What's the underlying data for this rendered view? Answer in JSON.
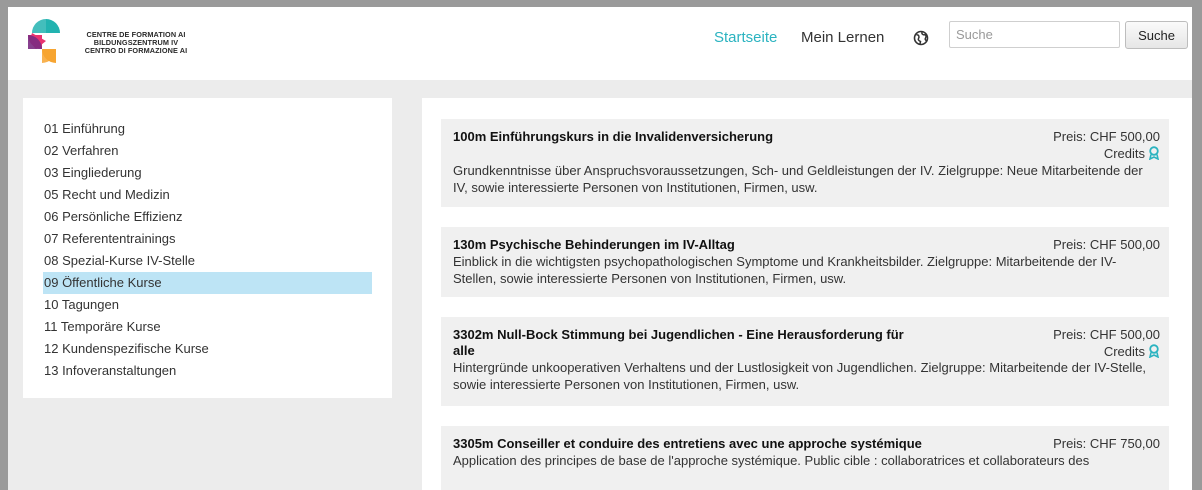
{
  "header": {
    "logo_lines": [
      "CENTRE DE FORMATION AI",
      "BILDUNGSZENTRUM IV",
      "CENTRO DI FORMAZIONE AI"
    ],
    "nav": {
      "home": "Startseite",
      "learn": "Mein Lernen"
    },
    "globe_icon": "globe-icon",
    "search": {
      "placeholder": "Suche",
      "value": "",
      "button": "Suche"
    }
  },
  "colors": {
    "accent": "#2bb3c0",
    "active_item": "#bde4f5",
    "page_bg": "#ececec",
    "card_bg": "#f0f0f0",
    "logo_teal": "#22b3b0",
    "logo_pink": "#e8336f",
    "logo_orange": "#f7a531",
    "logo_purple": "#7a2b82"
  },
  "sidebar": {
    "items": [
      {
        "label": "01 Einführung",
        "active": false
      },
      {
        "label": "02 Verfahren",
        "active": false
      },
      {
        "label": "03 Eingliederung",
        "active": false
      },
      {
        "label": "05 Recht und Medizin",
        "active": false
      },
      {
        "label": "06 Persönliche Effizienz",
        "active": false
      },
      {
        "label": "07 Referententrainings",
        "active": false
      },
      {
        "label": "08 Spezial-Kurse IV-Stelle",
        "active": false
      },
      {
        "label": "09 Öffentliche Kurse",
        "active": true
      },
      {
        "label": "10 Tagungen",
        "active": false
      },
      {
        "label": "11 Temporäre Kurse",
        "active": false
      },
      {
        "label": "12 Kundenspezifische Kurse",
        "active": false
      },
      {
        "label": "13 Infoveranstaltungen",
        "active": false
      }
    ]
  },
  "courses": [
    {
      "title": "100m Einführungskurs in die Invalidenversicherung",
      "price": "Preis: CHF 500,00",
      "credits": "Credits",
      "description": "Grundkenntnisse über Anspruchsvoraussetzungen, Sch- und Geldleistungen der IV. Zielgruppe: Neue Mitarbeitende der IV, sowie interessierte Personen von Institutionen, Firmen, usw."
    },
    {
      "title": "130m Psychische Behinderungen im IV-Alltag",
      "price": "Preis: CHF 500,00",
      "credits": "",
      "description": "Einblick in die wichtigsten psychopathologischen Symptome und Krankheitsbilder. Zielgruppe: Mitarbeitende der IV-Stellen, sowie interessierte Personen von Institutionen, Firmen, usw."
    },
    {
      "title": "3302m Null-Bock Stimmung bei Jugendlichen - Eine Herausforderung für alle",
      "price": "Preis: CHF 500,00",
      "credits": "Credits",
      "description": "Hintergründe unkooperativen Verhaltens und der Lustlosigkeit von Jugendlichen. Zielgruppe: Mitarbeitende der IV-Stelle, sowie interessierte Personen von Institutionen, Firmen, usw."
    },
    {
      "title": "3305m Conseiller et conduire des entretiens avec une approche systémique",
      "price": "Preis: CHF 750,00",
      "credits": "",
      "description": "Application des principes de base de l'approche systémique. Public cible : collaboratrices et collaborateurs des"
    }
  ]
}
